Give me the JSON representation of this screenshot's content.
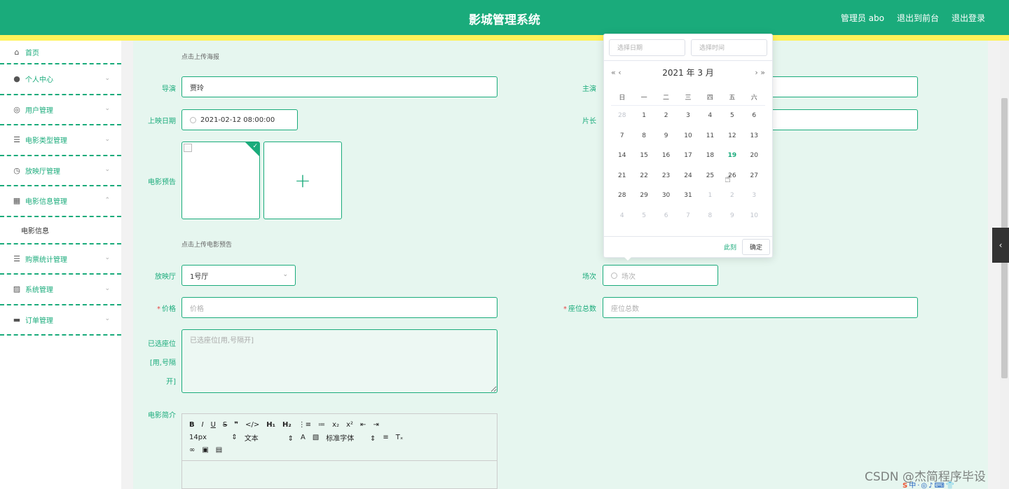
{
  "header": {
    "title": "影城管理系统",
    "admin": "管理员 abo",
    "exit_front": "退出到前台",
    "logout": "退出登录"
  },
  "sidebar": {
    "items": [
      {
        "label": "首页",
        "icon": "home-icon"
      },
      {
        "label": "个人中心",
        "icon": "user-icon"
      },
      {
        "label": "用户管理",
        "icon": "users-icon"
      },
      {
        "label": "电影类型管理",
        "icon": "list-icon"
      },
      {
        "label": "放映厅管理",
        "icon": "compass-icon"
      },
      {
        "label": "电影信息管理",
        "icon": "grid-icon",
        "expanded": true,
        "sub": "电影信息"
      },
      {
        "label": "购票统计管理",
        "icon": "list-icon"
      },
      {
        "label": "系统管理",
        "icon": "chart-icon"
      },
      {
        "label": "订单管理",
        "icon": "monitor-icon"
      }
    ]
  },
  "form": {
    "poster_hint": "点击上传海报",
    "director_label": "导演",
    "director_value": "贾玲",
    "actor_label": "主演",
    "release_label": "上映日期",
    "release_value": "2021-02-12 08:00:00",
    "length_label": "片长",
    "trailer_label": "电影预告",
    "trailer_hint": "点击上传电影预告",
    "hall_label": "放映厅",
    "hall_value": "1号厅",
    "session_label": "场次",
    "session_placeholder": "场次",
    "price_label": "价格",
    "price_placeholder": "价格",
    "seats_label": "座位总数",
    "seats_placeholder": "座位总数",
    "chosen_label_1": "已选座位",
    "chosen_label_2": "[用,号隔",
    "chosen_label_3": "开]",
    "chosen_placeholder": "已选座位[用,号隔开]",
    "intro_label": "电影简介"
  },
  "editor": {
    "font_size": "14px",
    "block": "文本",
    "font_family": "标准字体"
  },
  "datepicker": {
    "date_placeholder": "选择日期",
    "time_placeholder": "选择时间",
    "header": "2021 年  3 月",
    "weekdays": [
      "日",
      "一",
      "二",
      "三",
      "四",
      "五",
      "六"
    ],
    "today": "19",
    "days": [
      [
        "28",
        "1",
        "2",
        "3",
        "4",
        "5",
        "6"
      ],
      [
        "7",
        "8",
        "9",
        "10",
        "11",
        "12",
        "13"
      ],
      [
        "14",
        "15",
        "16",
        "17",
        "18",
        "19",
        "20"
      ],
      [
        "21",
        "22",
        "23",
        "24",
        "25",
        "26",
        "27"
      ],
      [
        "28",
        "29",
        "30",
        "31",
        "1",
        "2",
        "3"
      ],
      [
        "4",
        "5",
        "6",
        "7",
        "8",
        "9",
        "10"
      ]
    ],
    "now": "此刻",
    "confirm": "确定"
  },
  "watermark": "CSDN @杰简程序毕设",
  "colors": {
    "primary": "#1aab7b",
    "accent_yellow": "#fff25a",
    "content_bg": "#e6f6ef"
  }
}
